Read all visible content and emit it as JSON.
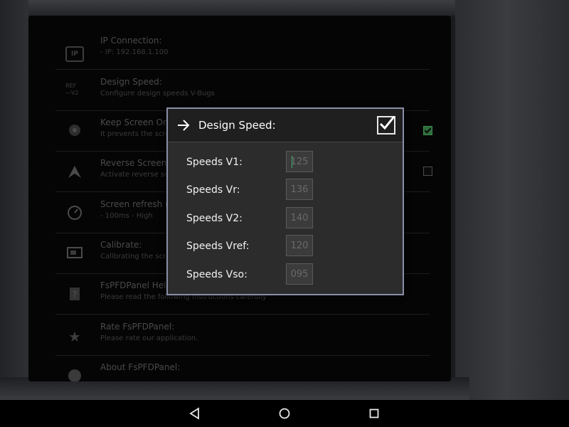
{
  "settings": {
    "items": [
      {
        "icon": "ip-icon",
        "title": "IP Connection:",
        "subtitle": "- IP: 192.168.1.100"
      },
      {
        "icon": "ref-v2-icon",
        "title": "Design Speed:",
        "subtitle": "Configure design speeds V-Bugs"
      },
      {
        "icon": "screen-icon",
        "title": "Keep Screen On:",
        "subtitle": "It prevents the scre",
        "checked": true
      },
      {
        "icon": "attitude-icon",
        "title": "Reverse Screen:",
        "subtitle": "Activate reverse sc",
        "checked": false
      },
      {
        "icon": "gauge-icon",
        "title": "Screen refresh ra",
        "subtitle": " - 100ms - High"
      },
      {
        "icon": "calibrate-icon",
        "title": "Calibrate:",
        "subtitle": "Calibrating the scre"
      },
      {
        "icon": "help-icon",
        "title": "FsPFDPanel Hel",
        "subtitle": "Please read the following instructions carefully"
      },
      {
        "icon": "star-icon",
        "title": "Rate FsPFDPanel:",
        "subtitle": "Please rate our application."
      },
      {
        "icon": "info-icon",
        "title": "About FsPFDPanel:",
        "subtitle": ""
      }
    ],
    "ip_badge": "IP",
    "ref_badge_top": "REF",
    "ref_badge_bottom": "V2"
  },
  "dialog": {
    "title": "Design Speed:",
    "fields": [
      {
        "label": "Speeds V1:",
        "value": "125"
      },
      {
        "label": "Speeds Vr:",
        "value": "136"
      },
      {
        "label": "Speeds V2:",
        "value": "140"
      },
      {
        "label": "Speeds Vref:",
        "value": "120"
      },
      {
        "label": "Speeds Vso:",
        "value": "095"
      }
    ]
  },
  "colors": {
    "dialog_border": "#8a8ea8",
    "checkbox_on": "#2e6b3a",
    "cursor": "#3fae6f"
  }
}
